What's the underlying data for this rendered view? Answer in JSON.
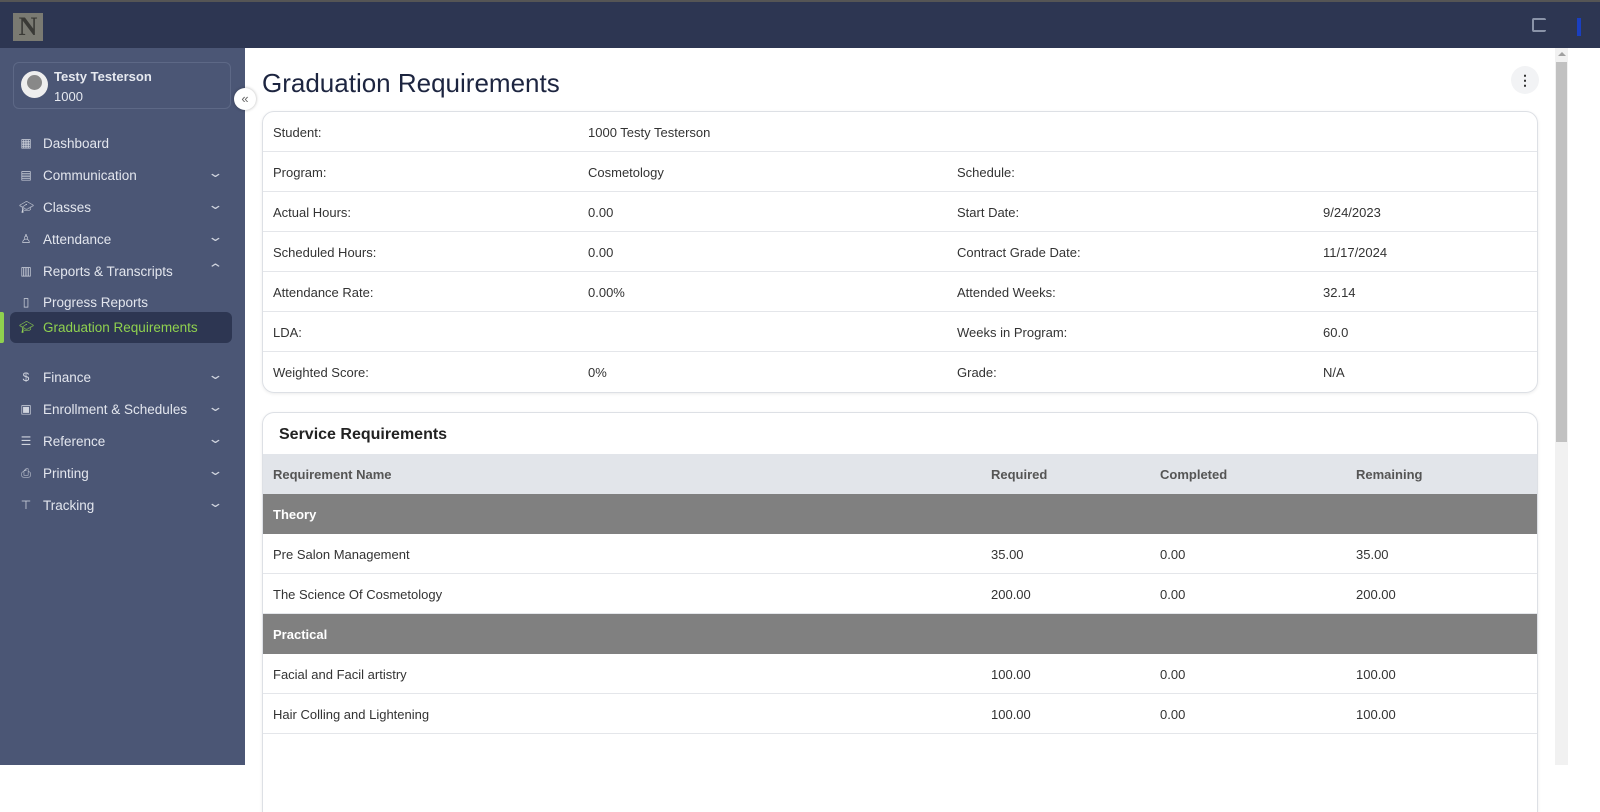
{
  "header": {
    "logo_text": "N"
  },
  "user": {
    "name": "Testy Testerson",
    "id": "1000"
  },
  "nav": [
    {
      "label": "Dashboard",
      "icon": "grid-icon",
      "chev": ""
    },
    {
      "label": "Communication",
      "icon": "chat-icon",
      "chev": "⌄"
    },
    {
      "label": "Classes",
      "icon": "graduation-cap-icon",
      "chev": "⌄"
    },
    {
      "label": "Attendance",
      "icon": "user-check-icon",
      "chev": "⌄"
    },
    {
      "label": "Reports & Transcripts",
      "icon": "report-icon",
      "chev": "⌃"
    },
    {
      "label": "Progress Reports",
      "icon": "document-chart-icon",
      "chev": ""
    },
    {
      "label": "Graduation Requirements",
      "icon": "graduation-cap-icon",
      "chev": ""
    },
    {
      "label": "Finance",
      "icon": "dollar-icon",
      "chev": "⌄"
    },
    {
      "label": "Enrollment & Schedules",
      "icon": "calendar-icon",
      "chev": "⌄"
    },
    {
      "label": "Reference",
      "icon": "sliders-icon",
      "chev": "⌄"
    },
    {
      "label": "Printing",
      "icon": "printer-icon",
      "chev": "⌄"
    },
    {
      "label": "Tracking",
      "icon": "signpost-icon",
      "chev": "⌄"
    }
  ],
  "page": {
    "title": "Graduation Requirements"
  },
  "info": [
    [
      "Student:",
      "1000 Testy  Testerson",
      "",
      ""
    ],
    [
      "Program:",
      "Cosmetology",
      "Schedule:",
      ""
    ],
    [
      "Actual Hours:",
      "0.00",
      "Start Date:",
      "9/24/2023"
    ],
    [
      "Scheduled Hours:",
      "0.00",
      "Contract Grade Date:",
      "11/17/2024"
    ],
    [
      "Attendance Rate:",
      "0.00%",
      "Attended Weeks:",
      "32.14"
    ],
    [
      "LDA:",
      "",
      "Weeks in Program:",
      "60.0"
    ],
    [
      "Weighted Score:",
      "0%",
      "Grade:",
      "N/A"
    ]
  ],
  "service": {
    "title": "Service Requirements",
    "columns": [
      "Requirement Name",
      "Required",
      "Completed",
      "Remaining"
    ],
    "groups": [
      {
        "name": "Theory",
        "rows": [
          [
            "Pre Salon Management",
            "35.00",
            "0.00",
            "35.00"
          ],
          [
            "The Science Of Cosmetology",
            "200.00",
            "0.00",
            "200.00"
          ]
        ]
      },
      {
        "name": "Practical",
        "rows": [
          [
            "Facial and Facil artistry",
            "100.00",
            "0.00",
            "100.00"
          ],
          [
            "Hair Colling and Lightening",
            "100.00",
            "0.00",
            "100.00"
          ]
        ]
      }
    ]
  }
}
